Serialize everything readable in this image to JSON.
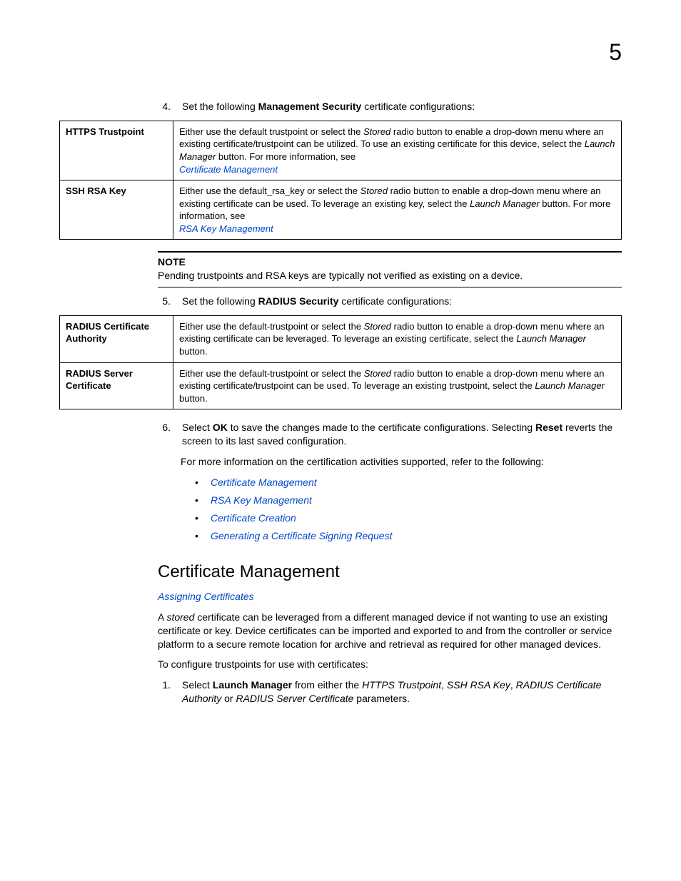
{
  "chapter_number": "5",
  "step4": {
    "num": "4.",
    "pre": "Set the following ",
    "bold": "Management Security",
    "post": " certificate configurations:"
  },
  "table1": {
    "row1": {
      "label": "HTTPS Trustpoint",
      "t1": "Either use the default trustpoint or select the ",
      "i1": "Stored",
      "t2": " radio button to enable a drop-down menu where an existing certificate/trustpoint can be utilized. To use an existing certificate for this device, select the ",
      "i2": "Launch Manager",
      "t3": " button. For more information, see",
      "link": "Certificate Management"
    },
    "row2": {
      "label": "SSH RSA Key",
      "t1": "Either use the default_rsa_key or select the ",
      "i1": "Stored",
      "t2": " radio button to enable a drop-down menu where an existing certificate can be used. To leverage an existing key, select the ",
      "i2": "Launch Manager",
      "t3": " button. For more information, see",
      "link": "RSA Key Management"
    }
  },
  "note": {
    "title": "NOTE",
    "body": "Pending trustpoints and RSA keys are typically not verified as existing on a device."
  },
  "step5": {
    "num": "5.",
    "pre": "Set the following ",
    "bold": "RADIUS Security",
    "post": " certificate configurations:"
  },
  "table2": {
    "row1": {
      "label": "RADIUS Certificate Authority",
      "t1": "Either use the default-trustpoint or select the ",
      "i1": "Stored",
      "t2": " radio button to enable a drop-down menu where an existing certificate can be leveraged. To leverage an existing certificate, select the ",
      "i2": "Launch Manager",
      "t3": " button."
    },
    "row2": {
      "label": "RADIUS Server Certificate",
      "t1": "Either use the default-trustpoint or select the ",
      "i1": "Stored",
      "t2": " radio button to enable a drop-down menu where an existing certificate/trustpoint can be used. To leverage an existing trustpoint, select the ",
      "i2": "Launch Manager",
      "t3": " button."
    }
  },
  "step6": {
    "num": "6.",
    "t1": "Select ",
    "b1": "OK",
    "t2": " to save the changes made to the certificate configurations. Selecting ",
    "b2": "Reset",
    "t3": " reverts the screen to its last saved configuration."
  },
  "followup": "For more information on the certification activities supported, refer to the following:",
  "bullets": {
    "b1": "Certificate Management",
    "b2": "RSA Key Management",
    "b3": "Certificate Creation",
    "b4": "Generating a Certificate Signing Request"
  },
  "section_heading": "Certificate Management",
  "section_sublink": "Assigning Certificates",
  "para1": {
    "t1": "A ",
    "i1": "stored",
    "t2": " certificate can be leveraged from a different managed device if not wanting to use an existing certificate or key. Device certificates can be imported and exported to and from the controller or service platform to a secure remote location for archive and retrieval as required for other managed devices."
  },
  "para2": "To configure trustpoints for use with certificates:",
  "step_cm1": {
    "num": "1.",
    "t1": "Select ",
    "b1": "Launch Manager",
    "t2": " from either the ",
    "i1": "HTTPS Trustpoint",
    "c1": ", ",
    "i2": "SSH RSA Key",
    "c2": ", ",
    "i3": "RADIUS Certificate Authority",
    "t3": " or ",
    "i4": "RADIUS Server Certificate",
    "t4": " parameters."
  }
}
